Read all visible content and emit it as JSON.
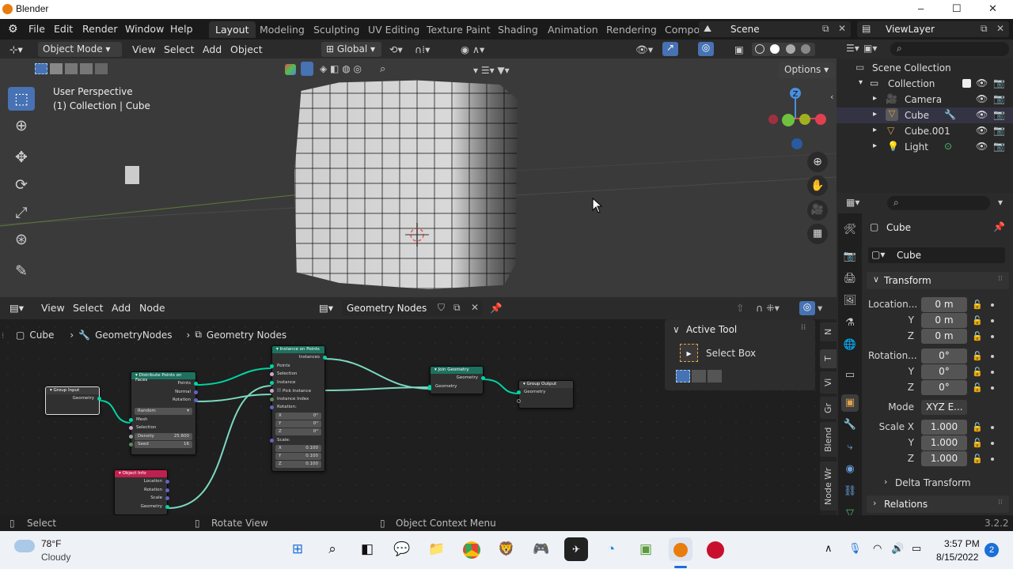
{
  "window": {
    "title": "Blender",
    "controls": [
      "–",
      "☐",
      "✕"
    ]
  },
  "menu": {
    "file": "File",
    "edit": "Edit",
    "render": "Render",
    "window": "Window",
    "help": "Help"
  },
  "workspaces": [
    "Layout",
    "Modeling",
    "Sculpting",
    "UV Editing",
    "Texture Paint",
    "Shading",
    "Animation",
    "Rendering",
    "Compo"
  ],
  "active_workspace": "Layout",
  "scene": {
    "name": "Scene",
    "view_layer": "ViewLayer"
  },
  "viewport_header": {
    "mode": "Object Mode",
    "view": "View",
    "select": "Select",
    "add": "Add",
    "object": "Object",
    "orientation": "Global",
    "options": "Options"
  },
  "viewport": {
    "perspective": "User Perspective",
    "collection_label": "(1) Collection | Cube",
    "gizmo_axis": "Z"
  },
  "node_editor": {
    "view": "View",
    "select": "Select",
    "add": "Add",
    "node": "Node",
    "tree_name": "Geometry Nodes",
    "breadcrumb": [
      "Cube",
      "GeometryNodes",
      "Geometry Nodes"
    ],
    "nodes": {
      "group_input": {
        "title": "Group Input",
        "geometry": "Geometry"
      },
      "distribute": {
        "title": "Distribute Points on Faces",
        "points": "Points",
        "normal": "Normal",
        "rotation": "Rotation",
        "method": "Random",
        "mesh": "Mesh",
        "selection": "Selection",
        "density_label": "Density",
        "density": "25.600",
        "seed_label": "Seed",
        "seed": "16"
      },
      "object_info": {
        "title": "Object Info",
        "location": "Location",
        "rotation": "Rotation",
        "scale": "Scale",
        "geometry": "Geometry"
      },
      "instance": {
        "title": "Instance on Points",
        "instances": "Instances",
        "points": "Points",
        "selection": "Selection",
        "instance": "Instance",
        "pick": "Pick Instance",
        "index": "Instance Index",
        "rotation": "Rotation:",
        "rx": "0°",
        "ry": "0°",
        "rz": "0°",
        "scale": "Scale:",
        "sx": "0.100",
        "sy": "0.100",
        "sz": "0.100",
        "x": "X",
        "y": "Y",
        "z": "Z"
      },
      "join": {
        "title": "Join Geometry",
        "geometry": "Geometry"
      },
      "group_output": {
        "title": "Group Output",
        "geometry": "Geometry"
      }
    },
    "active_tool": {
      "title": "Active Tool",
      "tool": "Select Box"
    },
    "side_tabs": [
      "N",
      "T",
      "Vi",
      "Gr",
      "Blend",
      "Node Wr"
    ]
  },
  "outliner": {
    "scene_collection": "Scene Collection",
    "items": [
      {
        "name": "Collection"
      },
      {
        "name": "Camera"
      },
      {
        "name": "Cube"
      },
      {
        "name": "Cube.001"
      },
      {
        "name": "Light"
      }
    ]
  },
  "properties": {
    "object_name": "Cube",
    "object_field": "Cube",
    "transform": "Transform",
    "location_label": "Location...",
    "loc": [
      "0 m",
      "0 m",
      "0 m"
    ],
    "rotation_label": "Rotation...",
    "rot": [
      "0°",
      "0°",
      "0°"
    ],
    "mode_label": "Mode",
    "mode": "XYZ E...",
    "scale_label": "Scale X",
    "scale": [
      "1.000",
      "1.000",
      "1.000"
    ],
    "y_label": "Y",
    "z_label": "Z",
    "delta": "Delta Transform",
    "relations": "Relations"
  },
  "statusbar": {
    "select": "Select",
    "rotate": "Rotate View",
    "context": "Object Context Menu",
    "version": "3.2.2"
  },
  "taskbar": {
    "temp": "78°F",
    "weather": "Cloudy",
    "time": "3:57 PM",
    "date": "8/15/2022",
    "notifications": "2"
  },
  "colors": {
    "accent": "#4772b3",
    "geometry_socket": "#00d6a3",
    "node_bg": "#303030",
    "viewport_bg": "#3a3a3a"
  }
}
